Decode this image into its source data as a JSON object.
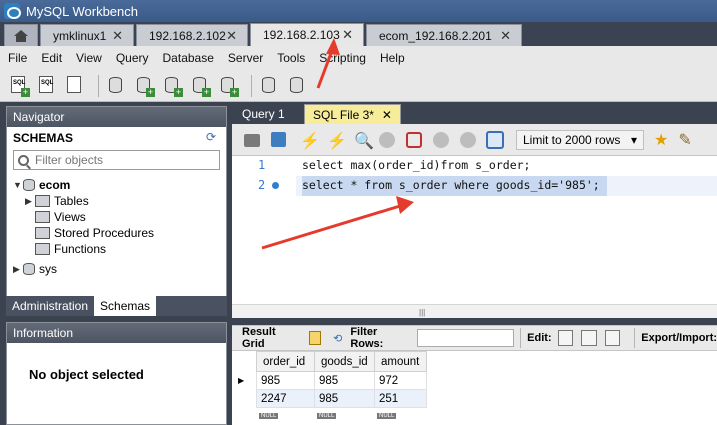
{
  "app": {
    "title": "MySQL Workbench"
  },
  "tabs": [
    {
      "label": "ymklinux1"
    },
    {
      "label": "192.168.2.102"
    },
    {
      "label": "192.168.2.103",
      "active": true
    },
    {
      "label": "ecom_192.168.2.201"
    }
  ],
  "menu": [
    "File",
    "Edit",
    "View",
    "Query",
    "Database",
    "Server",
    "Tools",
    "Scripting",
    "Help"
  ],
  "toolbar": {
    "sql_label": "SQL"
  },
  "navigator": {
    "title": "Navigator",
    "schemas_title": "SCHEMAS",
    "filter_placeholder": "Filter objects",
    "tree": {
      "db1": "ecom",
      "tables": "Tables",
      "views": "Views",
      "procedures": "Stored Procedures",
      "functions": "Functions",
      "db2": "sys"
    },
    "tabs": {
      "administration": "Administration",
      "schemas": "Schemas"
    }
  },
  "information": {
    "title": "Information",
    "message": "No object selected"
  },
  "editor": {
    "tabs": {
      "query1": "Query 1",
      "sqlfile": "SQL File 3*"
    },
    "limit_label": "Limit to 2000 rows",
    "lines": [
      {
        "number": "1",
        "text": "select max(order_id)from s_order;"
      },
      {
        "number": "2",
        "text": "select * from s_order where goods_id='985';"
      }
    ]
  },
  "result": {
    "grid_label": "Result Grid",
    "filter_label": "Filter Rows:",
    "edit_label": "Edit:",
    "export_label": "Export/Import:",
    "columns": [
      "order_id",
      "goods_id",
      "amount"
    ],
    "rows": [
      [
        "985",
        "985",
        "972"
      ],
      [
        "2247",
        "985",
        "251"
      ]
    ],
    "null_label": "NULL"
  },
  "colors": {
    "annotation_arrow": "#e53b2c",
    "selection": "#c7d8f0"
  }
}
